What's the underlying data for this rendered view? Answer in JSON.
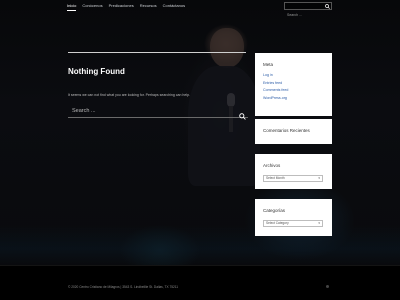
{
  "nav": {
    "items": [
      "Inicio",
      "Conócenos",
      "Predicaciones",
      "Recursos",
      "Contáctanos"
    ],
    "search_placeholder": "Search ..."
  },
  "main": {
    "title": "Nothing Found",
    "message": "It seems we can not find what you are looking for. Perhaps searching can help.",
    "search_placeholder": "Search ..."
  },
  "sidebar": {
    "meta": {
      "title": "Meta",
      "links": [
        "Log in",
        "Entries feed",
        "Comments feed",
        "WordPress.org"
      ]
    },
    "recent_comments": {
      "title": "Comentarios Recientes"
    },
    "archives": {
      "title": "Archivos",
      "select_label": "Select Month"
    },
    "categories": {
      "title": "Categorías",
      "select_label": "Select Category"
    }
  },
  "footer": {
    "text": "© 2020 Centro Cristiano de Milagros | 3543 S. Lindbeillie St. Dallas, TX 75211"
  },
  "colors": {
    "link": "#2a5ba7",
    "background": "#000000",
    "widget_bg": "#ffffff"
  },
  "icons": {
    "search": "search-icon",
    "dropdown": "chevron-down-icon"
  }
}
